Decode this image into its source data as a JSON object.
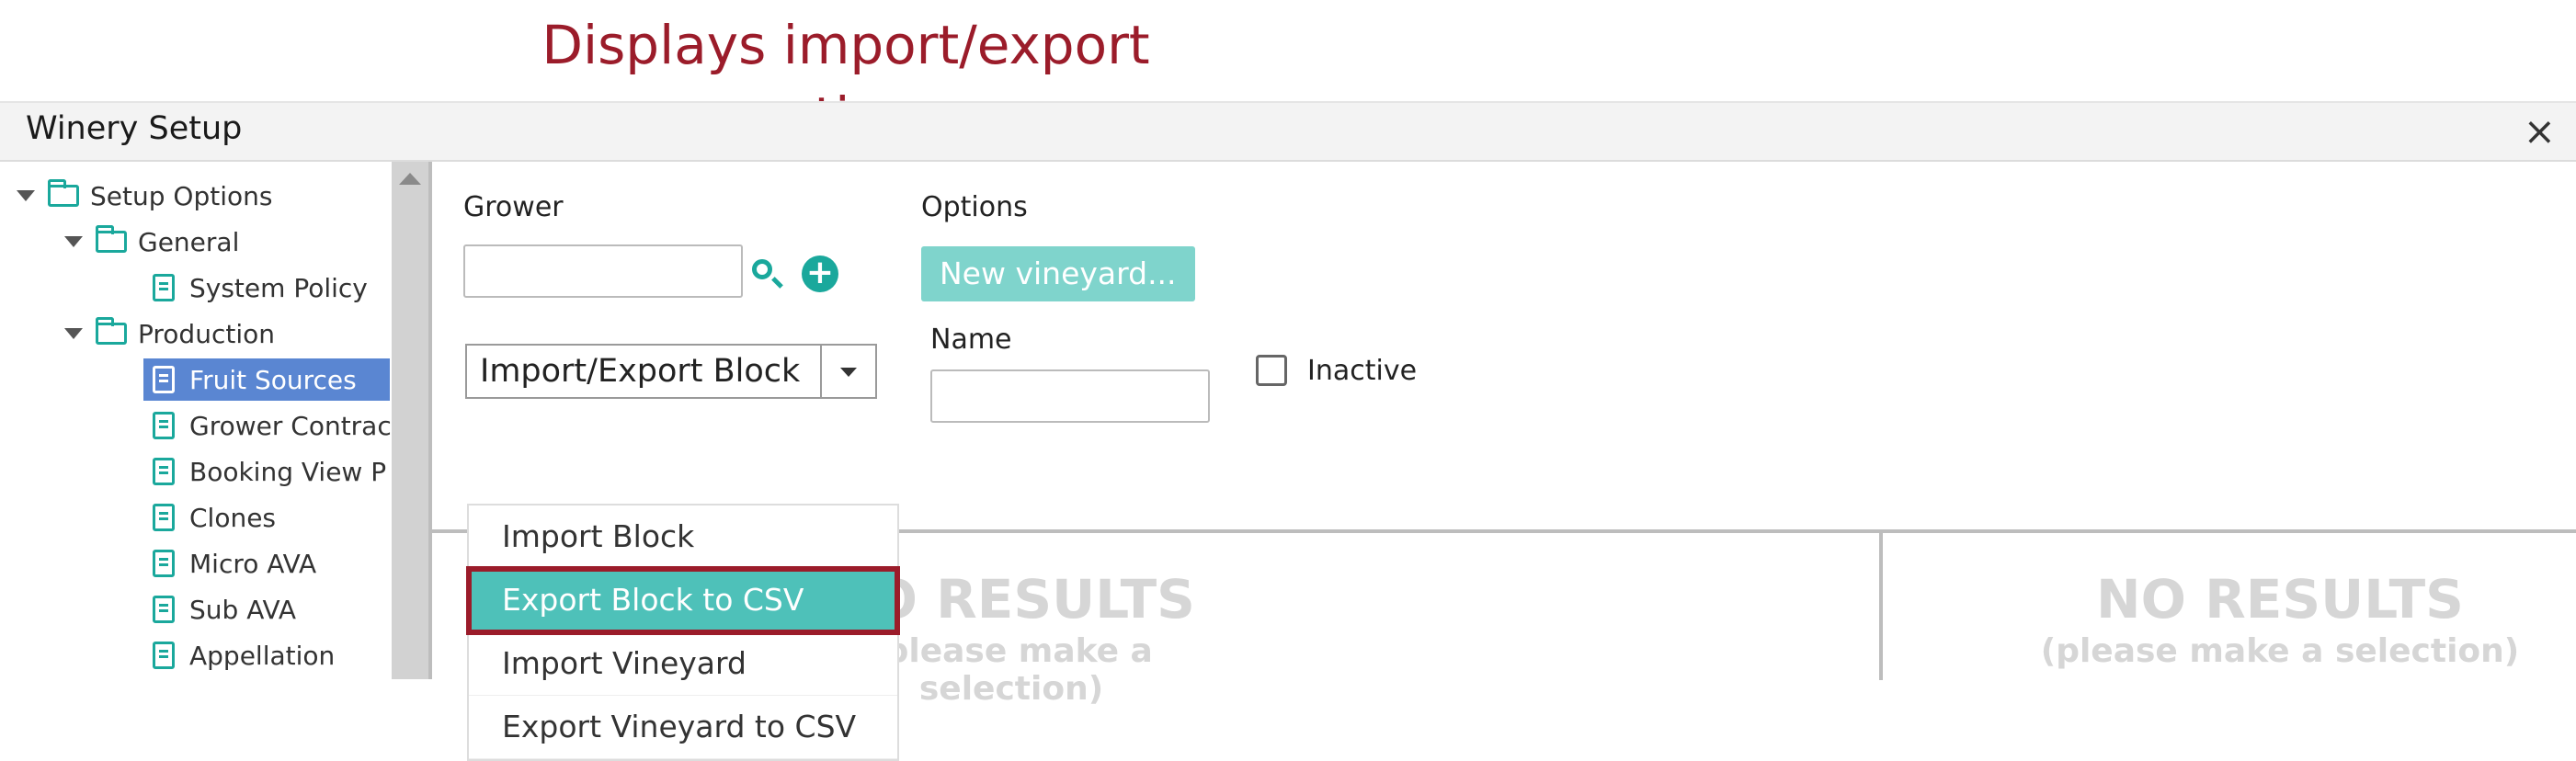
{
  "annotation": {
    "line1": "Displays import/export",
    "line2": "options"
  },
  "window": {
    "title": "Winery Setup",
    "close_label": "×"
  },
  "tree": {
    "root": "Setup Options",
    "general": "General",
    "system_policy": "System Policy",
    "production": "Production",
    "items": [
      "Fruit Sources",
      "Grower Contract",
      "Booking View P",
      "Clones",
      "Micro AVA",
      "Sub AVA",
      "Appellation"
    ],
    "selected": "Fruit Sources"
  },
  "form": {
    "grower_label": "Grower",
    "grower_value": "",
    "options_label": "Options",
    "new_vineyard_button": "New vineyard...",
    "select_value": "Import/Export Block",
    "name_label": "Name",
    "name_value": "",
    "inactive_label": "Inactive"
  },
  "dropdown": {
    "options": [
      "Import Block",
      "Export Block to CSV",
      "Import Vineyard",
      "Export Vineyard to CSV"
    ],
    "highlighted": "Export Block to CSV"
  },
  "results": {
    "no_results": "NO RESULTS",
    "hint": "(please make a selection)"
  },
  "colors": {
    "accent": "#1aa89c",
    "annotation": "#9b1c2a",
    "selected_tree": "#5a86d2",
    "dropdown_highlight": "#4ec1b9"
  }
}
